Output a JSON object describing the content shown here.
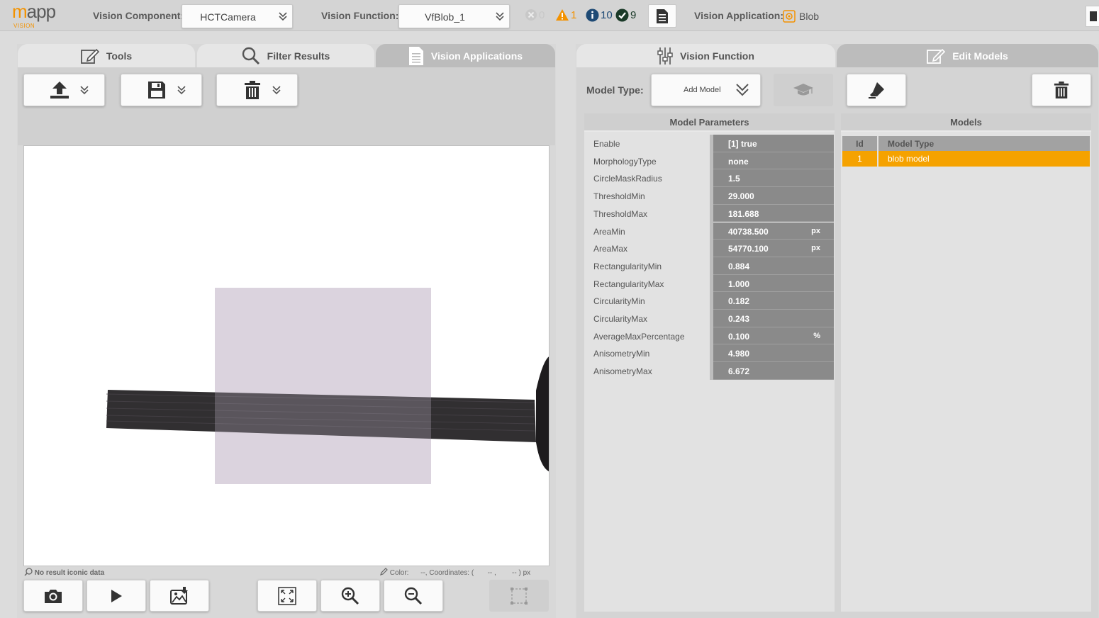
{
  "logo": {
    "word_prefix": "m",
    "word_rest": "app",
    "sub": "VISION"
  },
  "topbar": {
    "vision_component_label": "Vision Component:",
    "vision_component_value": "HCTCamera",
    "vision_function_label": "Vision Function:",
    "vision_function_value": "VfBlob_1",
    "errors": "0",
    "warnings": "1",
    "infos": "10",
    "ok": "9",
    "vision_application_label": "Vision Application:",
    "vision_application_value": "Blob"
  },
  "left_tabs": [
    {
      "label": "Tools",
      "icon": "edit-icon",
      "active": false
    },
    {
      "label": "Filter Results",
      "icon": "search-icon",
      "active": false
    },
    {
      "label": "Vision Applications",
      "icon": "document-icon",
      "active": true
    }
  ],
  "right_tabs": [
    {
      "label": "Vision Function",
      "icon": "sliders-icon",
      "active": false
    },
    {
      "label": "Edit Models",
      "icon": "edit-icon",
      "active": true
    }
  ],
  "viewer": {
    "status_left": "No result iconic data",
    "status_right": "Color:      --, Coordinates: (       -- ,        -- ) px"
  },
  "model_type": {
    "label": "Model Type:",
    "value": "Add Model"
  },
  "model_parameters": {
    "title": "Model Parameters",
    "rows": [
      {
        "name": "Enable",
        "value": "[1] true",
        "unit": ""
      },
      {
        "name": "MorphologyType",
        "value": "none",
        "unit": ""
      },
      {
        "name": "CircleMaskRadius",
        "value": "1.5",
        "unit": ""
      },
      {
        "name": "ThresholdMin",
        "value": "29.000",
        "unit": ""
      },
      {
        "name": "ThresholdMax",
        "value": "181.688",
        "unit": ""
      },
      {
        "name": "AreaMin",
        "value": "40738.500",
        "unit": "px"
      },
      {
        "name": "AreaMax",
        "value": "54770.100",
        "unit": "px"
      },
      {
        "name": "RectangularityMin",
        "value": "0.884",
        "unit": ""
      },
      {
        "name": "RectangularityMax",
        "value": "1.000",
        "unit": ""
      },
      {
        "name": "CircularityMin",
        "value": "0.182",
        "unit": ""
      },
      {
        "name": "CircularityMax",
        "value": "0.243",
        "unit": ""
      },
      {
        "name": "AverageMaxPercentage",
        "value": "0.100",
        "unit": "%"
      },
      {
        "name": "AnisometryMin",
        "value": "4.980",
        "unit": ""
      },
      {
        "name": "AnisometryMax",
        "value": "6.672",
        "unit": ""
      }
    ]
  },
  "models": {
    "title": "Models",
    "columns": [
      "Id",
      "Model Type"
    ],
    "rows": [
      {
        "id": "1",
        "type": "blob model"
      }
    ]
  },
  "colors": {
    "accent": "#f39200",
    "selected_row": "#f5a200",
    "value_bg": "#8a8a8a"
  }
}
